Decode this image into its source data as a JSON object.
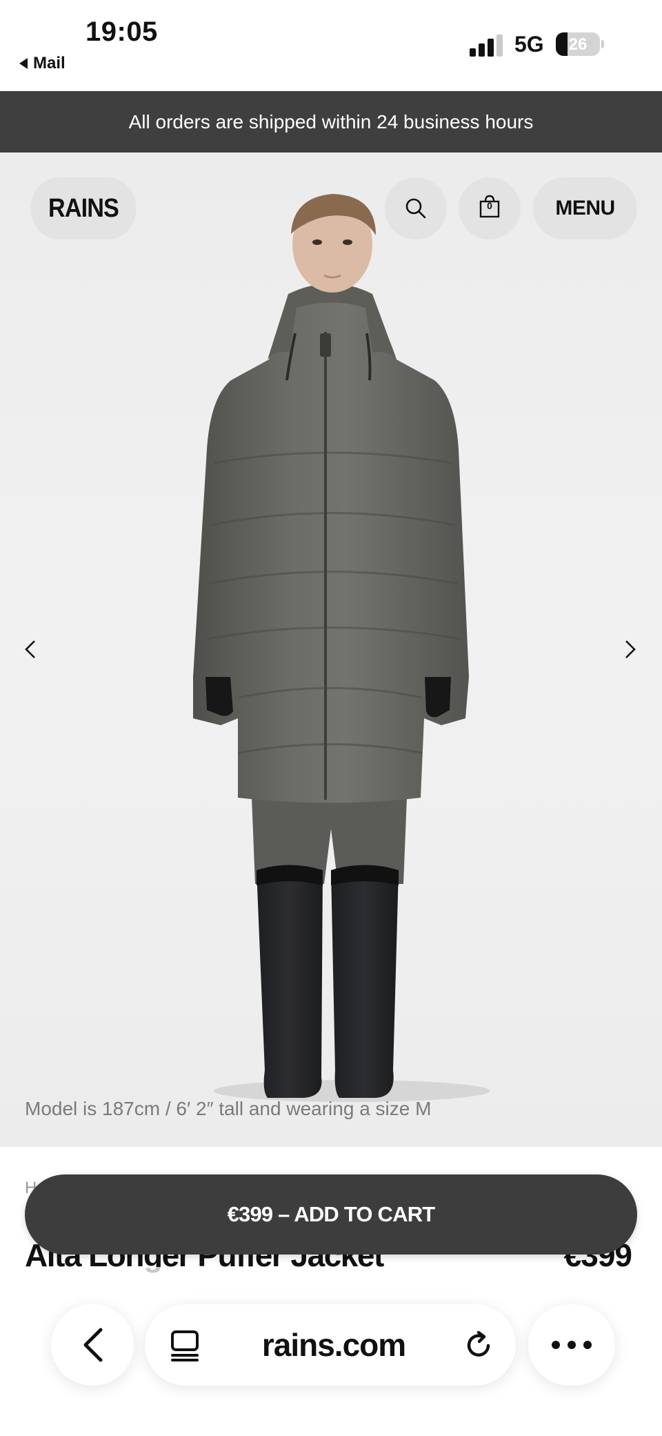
{
  "status_bar": {
    "time": "19:05",
    "back_app": "Mail",
    "network": "5G",
    "battery_level": "26",
    "battery_fraction": 0.26
  },
  "announcement": {
    "text": "All orders are shipped within 24 business hours"
  },
  "header": {
    "logo": "RAINS",
    "search_icon": "search-icon",
    "bag_icon": "shopping-bag-icon",
    "bag_count": "0",
    "menu_label": "MENU"
  },
  "gallery": {
    "prev_icon": "chevron-left-icon",
    "next_icon": "chevron-right-icon",
    "caption": "Model is 187cm / 6′ 2″ tall and wearing a size M"
  },
  "product": {
    "breadcrumb_peek": "H",
    "title": "Alta Longer Puffer Jacket",
    "price": "€399"
  },
  "cart_button": {
    "label": "€399 – ADD TO CART"
  },
  "browser": {
    "url": "rains.com",
    "back_icon": "chevron-left-icon",
    "tabs_icon": "tabs-icon",
    "reload_icon": "reload-icon",
    "more_icon": "more-icon"
  }
}
